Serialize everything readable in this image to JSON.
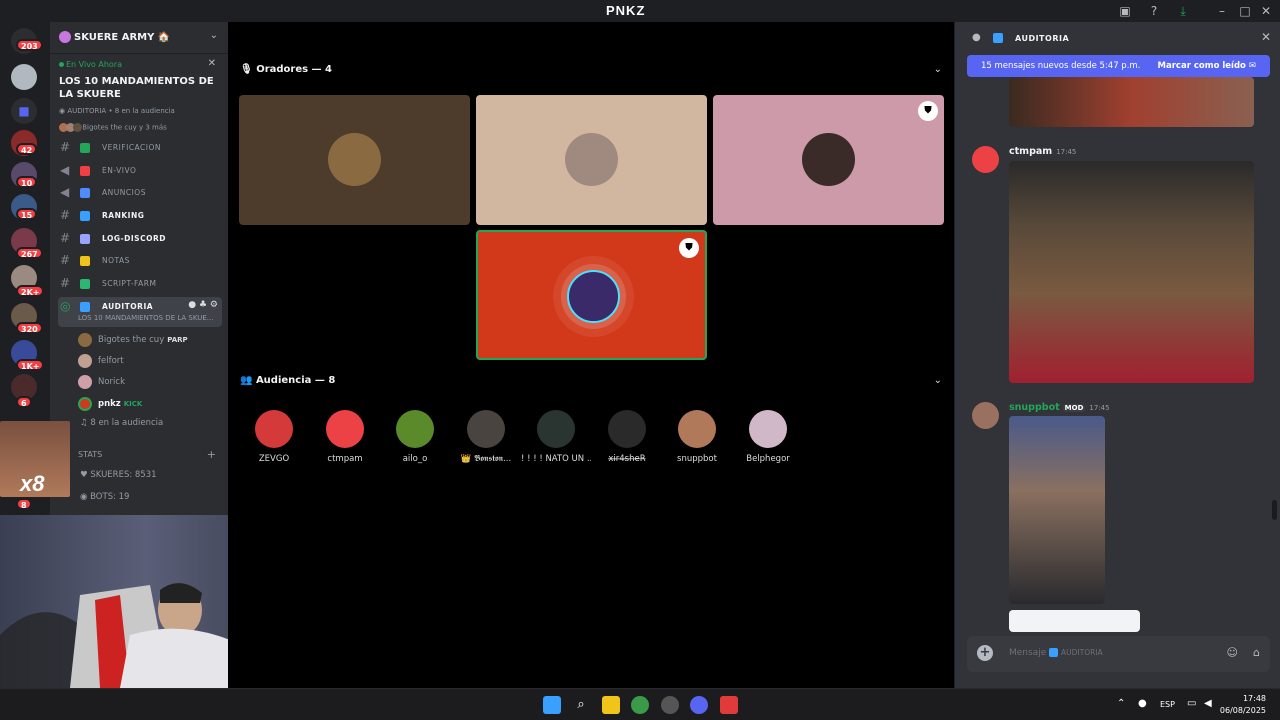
{
  "window": {
    "title": "PNKZ"
  },
  "server": {
    "name": "SKUERE ARMY 🏠"
  },
  "live": {
    "tag": "En Vivo Ahora",
    "title": "LOS 10 MANDAMIENTOS DE LA SKUERE",
    "meta": "AUDITORIA • 8 en la audiencia",
    "people": "Bigotes the cuy y 3 más"
  },
  "rail_badges": [
    "203",
    "42",
    "10",
    "15",
    "267",
    "2K+",
    "320",
    "1K+",
    "6",
    "8"
  ],
  "channels": [
    {
      "label": "VERIFICACION",
      "color": "#23a55a",
      "kind": "hash"
    },
    {
      "label": "EN-VIVO",
      "color": "#f23f43",
      "kind": "speaker"
    },
    {
      "label": "ANUNCIOS",
      "color": "#4e8cff",
      "kind": "speaker"
    },
    {
      "label": "RANKING",
      "color": "#3aa0ff",
      "kind": "hash",
      "bold": true
    },
    {
      "label": "LOG-DISCORD",
      "color": "#9aa4ff",
      "kind": "hash",
      "bold": true
    },
    {
      "label": "NOTAS",
      "color": "#f0c419",
      "kind": "hash"
    },
    {
      "label": "SCRIPT-FARM",
      "color": "#2bb673",
      "kind": "hash"
    }
  ],
  "active_channel": {
    "label": "AUDITORIA",
    "sub": "LOS 10 MANDAMIENTOS DE LA SKUE..."
  },
  "members": [
    {
      "name": "Bigotes the cuy",
      "tag": "PARP"
    },
    {
      "name": "felfort",
      "tag": ""
    },
    {
      "name": "Norick",
      "tag": ""
    },
    {
      "name": "pnkz",
      "tag": "KICK"
    }
  ],
  "audience_line": "8 en la audiencia",
  "stats": {
    "category": "STATS",
    "skueres": "SKUERES: 8531",
    "bots": "BOTS: 19"
  },
  "stage": {
    "speakers_header": "Oradores — 4",
    "audience_header": "Audiencia — 8",
    "speaker_tiles": [
      {
        "bg": "#4d3b2c",
        "av": "#8a6a40",
        "shield": false
      },
      {
        "bg": "#d1b79f",
        "av": "#a08a80",
        "shield": false
      },
      {
        "bg": "#cc9aa8",
        "av": "#3a2a28",
        "shield": true
      },
      {
        "bg": "#d2381a",
        "av": "#3a2a6a",
        "shield": true
      }
    ],
    "audience": [
      {
        "name": "ZEVGO",
        "color": "#d43a3a"
      },
      {
        "name": "ctmpam",
        "color": "#ed4245"
      },
      {
        "name": "ailo_o",
        "color": "#5a8a2a"
      },
      {
        "name": "👑 𝕭𝖔𝖓𝖘𝖙𝖔𝖓...",
        "color": "#4a4440"
      },
      {
        "name": "! ! ! ! ÑATO UN ...",
        "color": "#2a3430"
      },
      {
        "name": "x̶i̶r̶4̶s̶h̶e̶R̶",
        "color": "#2a2a2a"
      },
      {
        "name": "snuppbot",
        "color": "#b07a5a"
      },
      {
        "name": "Belphegor",
        "color": "#d0b8c8"
      }
    ]
  },
  "chat": {
    "title": "AUDITORIA",
    "new_messages": "15 mensajes nuevos desde 5:47 p.m.",
    "mark_read": "Marcar como leído",
    "messages": [
      {
        "user": "ctmpam",
        "time": "17:45",
        "color": "#f2f3f5",
        "mod": ""
      },
      {
        "user": "snuppbot",
        "time": "17:45",
        "color": "#23a55a",
        "mod": "MOD"
      }
    ],
    "input_placeholder": "Mensaje",
    "input_channel": "AUDITORIA"
  },
  "taskbar": {
    "lang": "ESP",
    "time": "17:48",
    "date": "06/08/2025"
  }
}
